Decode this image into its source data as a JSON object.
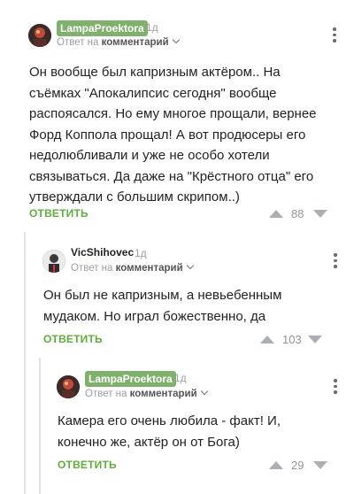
{
  "colors": {
    "badge": "#7fb06c",
    "reply_action": "#5fae3a",
    "muted": "#9aa0a5",
    "thread_line": "#e3e3e3"
  },
  "icons": {
    "menu": "vertical-ellipsis-icon",
    "expand": "chevron-down-icon",
    "upvote": "triangle-up-icon",
    "downvote": "triangle-down-icon"
  },
  "comments": [
    {
      "username": "LampaProektora",
      "age": "1д",
      "reply_prefix": "Ответ на",
      "reply_target": "комментарий",
      "text": "Он вообще был капризным актёром.. На съёмках \"Апокалипсис сегодня\" вообще распоясался. Но ему многое прощали, вернее Форд Коппола прощал! А вот продюсеры его недолюбливали и уже не особо хотели связываться. Да даже на \"Крёстного отца\" его утверждали с большим скрипом..)",
      "reply_label": "ОТВЕТИТЬ",
      "score": "88"
    },
    {
      "username": "VicShihovec",
      "age": "1д",
      "reply_prefix": "Ответ на",
      "reply_target": "комментарий",
      "text": "Он был не капризным, а невьебенным мудаком. Но играл божественно, да",
      "reply_label": "ОТВЕТИТЬ",
      "score": "103"
    },
    {
      "username": "LampaProektora",
      "age": "1д",
      "reply_prefix": "Ответ на",
      "reply_target": "комментарий",
      "text": "Камера его очень любила - факт! И, конечно же, актёр он от Бога)",
      "reply_label": "ОТВЕТИТЬ",
      "score": "29"
    }
  ]
}
